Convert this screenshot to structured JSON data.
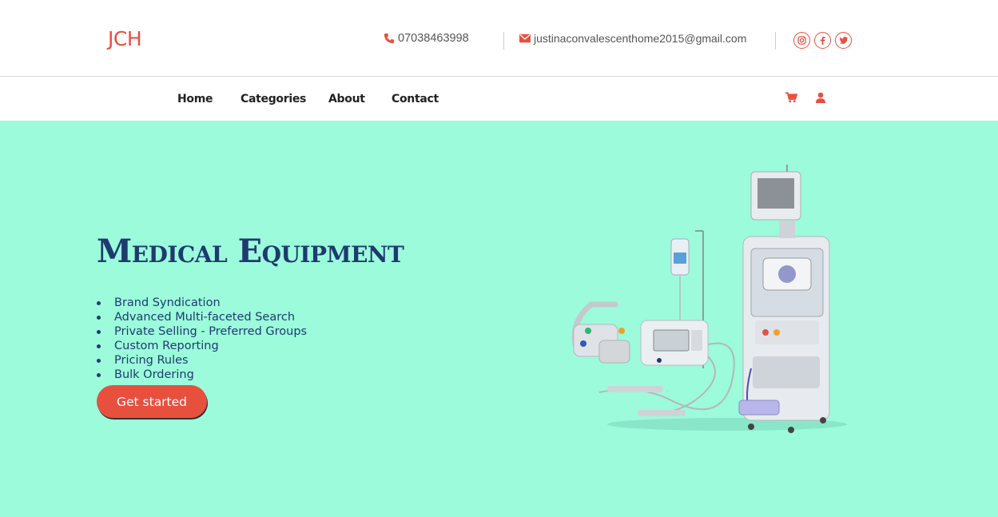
{
  "header": {
    "logo": "JCH",
    "phone": "07038463998",
    "email": "justinaconvalescenthome2015@gmail.com",
    "socials": [
      {
        "icon": "instagram-icon",
        "glyph": "◎"
      },
      {
        "icon": "facebook-icon",
        "glyph": "f"
      },
      {
        "icon": "twitter-icon",
        "glyph": "t"
      }
    ]
  },
  "nav": {
    "items": [
      "Home",
      "Categories",
      "About",
      "Contact"
    ],
    "icons": [
      "cart-icon",
      "user-icon"
    ]
  },
  "hero": {
    "title": "Medical Equipment",
    "features": [
      "Brand Syndication",
      "Advanced Multi-faceted Search",
      "Private Selling - Preferred Groups",
      "Custom Reporting",
      "Pricing Rules",
      "Bulk Ordering"
    ],
    "cta_label": "Get started",
    "image": "medical-equipment-image"
  },
  "colors": {
    "accent": "#e8503e",
    "hero_bg": "#9bfbdb",
    "title": "#1f3a6e"
  }
}
